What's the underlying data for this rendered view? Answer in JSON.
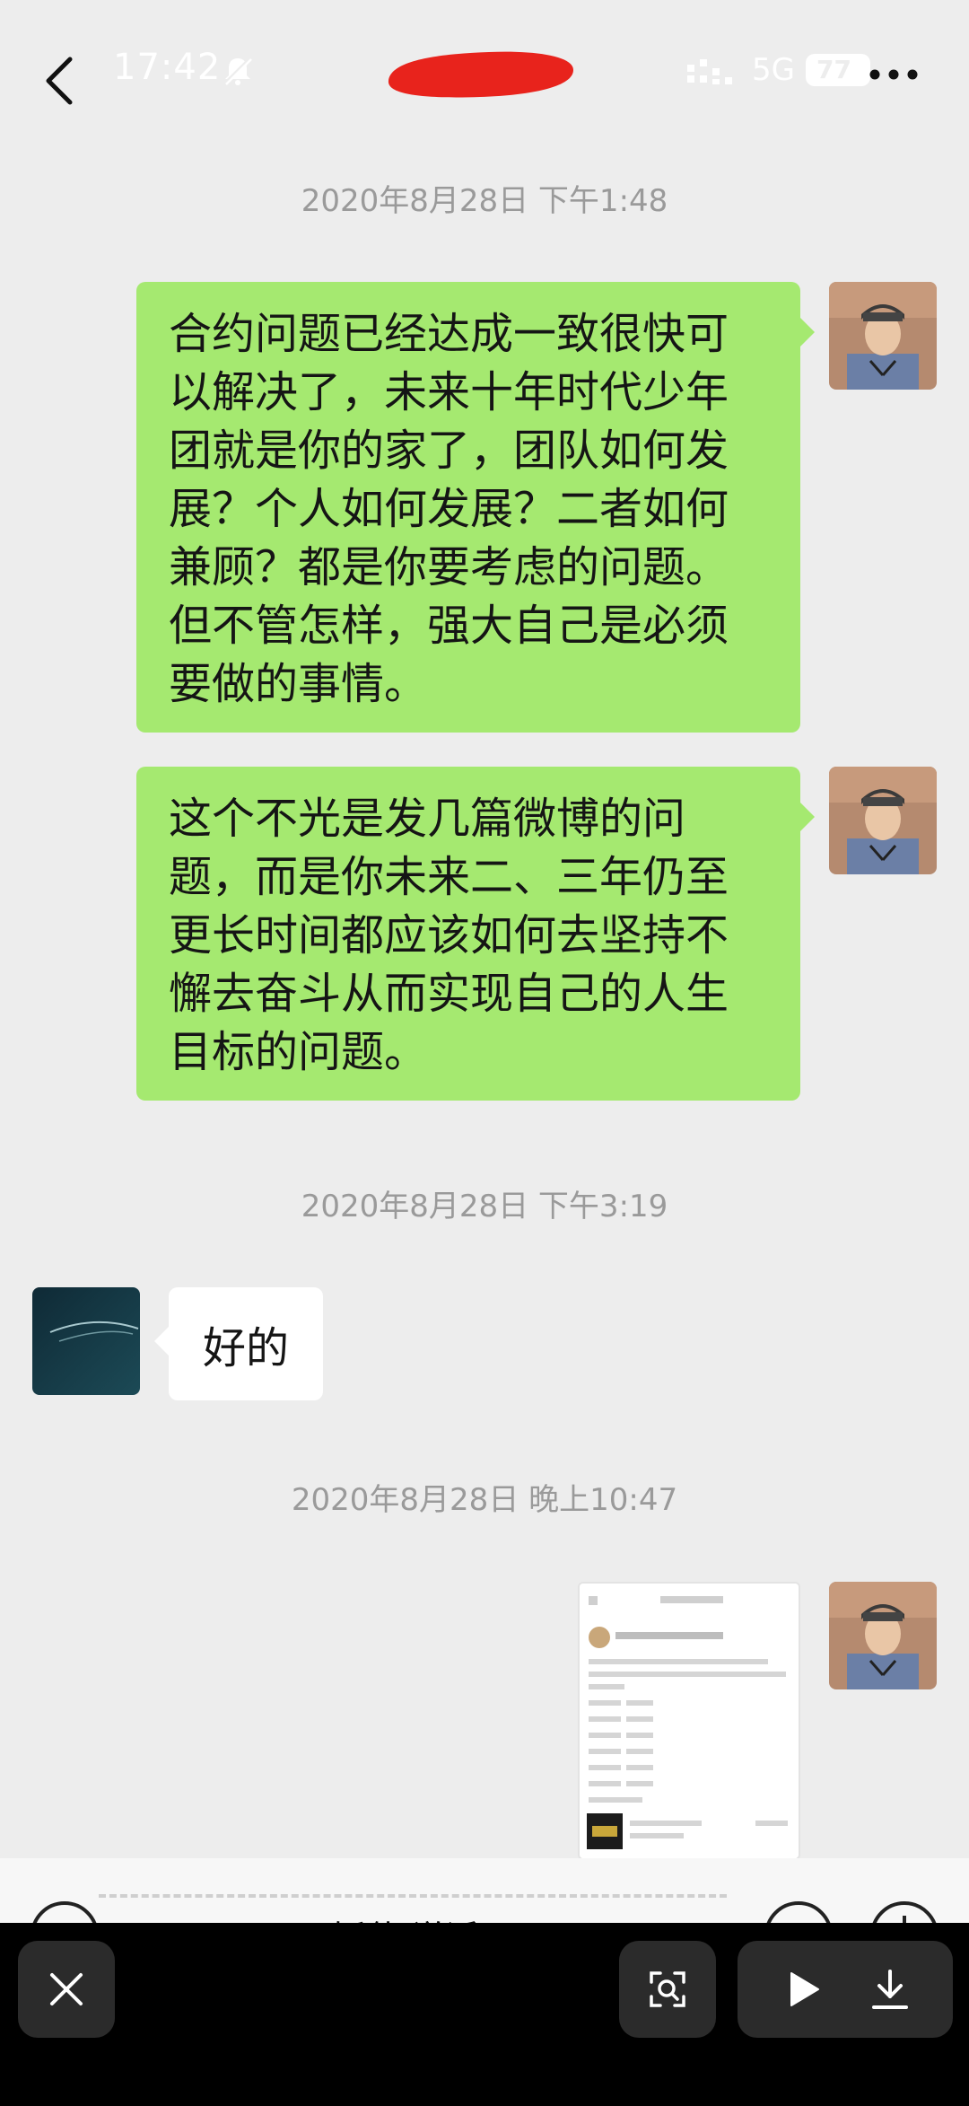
{
  "status_bar": {
    "time": "17:42",
    "network": "5G",
    "battery": "77",
    "icons": [
      "bell-muted-icon",
      "signal-icon",
      "more-icon"
    ]
  },
  "header": {
    "back_icon": "chevron-left-icon",
    "more_icon": "ellipsis-icon"
  },
  "messages": [
    {
      "type": "timestamp",
      "text": "2020年8月28日 下午1:48"
    },
    {
      "type": "text",
      "side": "right",
      "text": "合约问题已经达成一致很快可以解决了，未来十年时代少年团就是你的家了，团队如何发展？个人如何发展？二者如何兼顾？都是你要考虑的问题。但不管怎样，强大自己是必须要做的事情。"
    },
    {
      "type": "text",
      "side": "right",
      "text": "这个不光是发几篇微博的问题，而是你未来二、三年仍至更长时间都应该如何去坚持不懈去奋斗从而实现自己的人生目标的问题。"
    },
    {
      "type": "timestamp",
      "text": "2020年8月28日 下午3:19"
    },
    {
      "type": "text",
      "side": "left",
      "text": "好的"
    },
    {
      "type": "timestamp",
      "text": "2020年8月28日 晚上10:47"
    },
    {
      "type": "image",
      "side": "right"
    }
  ],
  "input_bar": {
    "peek_text": "饭什 说话"
  },
  "bottom_toolbar": {
    "icons": [
      "close-icon",
      "scan-icon",
      "play-icon",
      "download-icon"
    ]
  },
  "colors": {
    "background": "#ededed",
    "sent_bubble": "#a5e970",
    "received_bubble": "#ffffff",
    "timestamp": "#9a9a9a",
    "toolbar": "#000000",
    "redaction": "#e8231c"
  }
}
